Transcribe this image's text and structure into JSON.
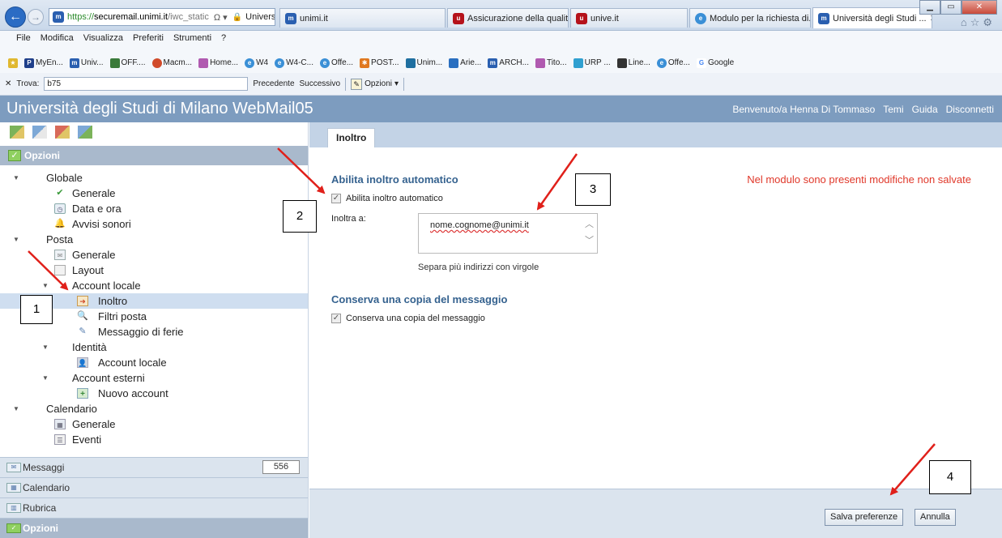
{
  "browser": {
    "url_https": "https://",
    "url_host": "securemail.unimi.it",
    "url_rest": "/iwc_static",
    "url_ctrl": "Ω ▾",
    "url_site": "Università degl...",
    "tabs": [
      {
        "label": "unimi.it",
        "icon": "unimi-favicon"
      },
      {
        "label": "Assicurazione della qualit...",
        "icon": "red-favicon"
      },
      {
        "label": "unive.it",
        "icon": "red-favicon"
      },
      {
        "label": "Modulo per la richiesta di...",
        "icon": "ie-favicon"
      },
      {
        "label": "Università degli Studi ...",
        "icon": "unimi-favicon",
        "active": true
      }
    ],
    "menu": [
      "File",
      "Modifica",
      "Visualizza",
      "Preferiti",
      "Strumenti",
      "?"
    ],
    "bookmarks": [
      "MyEn...",
      "Univ...",
      "OFF....",
      "Macm...",
      "Home...",
      "W4",
      "W4-C...",
      "Offe...",
      "POST...",
      "Unim...",
      "Arie...",
      "ARCH...",
      "Tito...",
      "URP ...",
      "Line...",
      "Offe...",
      "Google"
    ],
    "find": {
      "label": "Trova:",
      "value": "b75",
      "prev": "Precedente",
      "next": "Successivo",
      "options": "Opzioni"
    }
  },
  "app": {
    "title": "Università degli Studi di Milano WebMail05",
    "welcome": "Benvenuto/a Henna Di Tommaso",
    "links": [
      "Temi",
      "Guida",
      "Disconnetti"
    ]
  },
  "left": {
    "header": "Opzioni",
    "tree": [
      {
        "label": "Globale"
      },
      {
        "label": "Generale",
        "icon": "check-icon"
      },
      {
        "label": "Data e ora",
        "icon": "clock-icon"
      },
      {
        "label": "Avvisi sonori",
        "icon": "bell-icon"
      },
      {
        "label": "Posta"
      },
      {
        "label": "Generale",
        "icon": "mail-icon"
      },
      {
        "label": "Layout",
        "icon": "layout-icon"
      },
      {
        "label": "Account locale"
      },
      {
        "label": "Inoltro",
        "icon": "forward-icon",
        "selected": true
      },
      {
        "label": "Filtri posta",
        "icon": "search-icon"
      },
      {
        "label": "Messaggio di ferie",
        "icon": "pencil-icon"
      },
      {
        "label": "Identità"
      },
      {
        "label": "Account locale",
        "icon": "user-icon"
      },
      {
        "label": "Account esterni"
      },
      {
        "label": "Nuovo account",
        "icon": "add-icon"
      },
      {
        "label": "Calendario"
      },
      {
        "label": "Generale",
        "icon": "calendar-icon"
      },
      {
        "label": "Eventi",
        "icon": "list-icon"
      }
    ],
    "nav": {
      "messages": "Messaggi",
      "messages_count": "556",
      "calendar": "Calendario",
      "contacts": "Rubrica",
      "options": "Opzioni"
    }
  },
  "right": {
    "tab": "Inoltro",
    "section1": "Abilita inoltro automatico",
    "enable_label": "Abilita inoltro automatico",
    "enable_checked": true,
    "forward_to_label": "Inoltra a:",
    "forward_to_value": "nome.cognome@unimi.it",
    "hint": "Separa più indirizzi con virgole",
    "section2": "Conserva una copia del messaggio",
    "keep_label": "Conserva una copia del messaggio",
    "keep_checked": true,
    "unsaved_warning": "Nel modulo sono presenti modifiche non salvate",
    "save_button": "Salva preferenze",
    "cancel_button": "Annulla"
  },
  "annotations": [
    "1",
    "2",
    "3",
    "4"
  ],
  "colors": {
    "header": "#7d9cbf",
    "section_title": "#35628f",
    "warning": "#e0382a",
    "arrow": "#e0201a"
  }
}
